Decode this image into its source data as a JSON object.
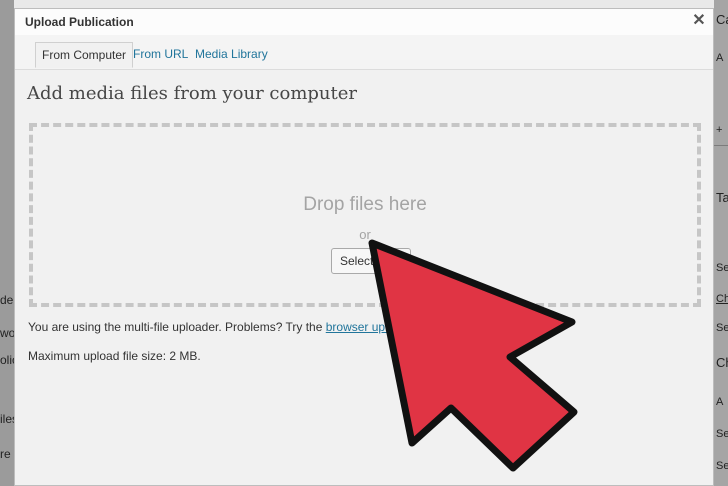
{
  "modal": {
    "title": "Upload Publication",
    "close_icon": "close-icon",
    "tabs": [
      {
        "label": "From Computer",
        "active": true
      },
      {
        "label": "From URL",
        "active": false
      },
      {
        "label": "Media Library",
        "active": false
      }
    ],
    "heading": "Add media files from your computer",
    "dropzone": {
      "drop_text": "Drop files here",
      "or_text": "or",
      "select_button": "Select Files"
    },
    "info": {
      "prefix": "You are using the multi-file uploader. Problems? Try the ",
      "link": "browser uplo"
    },
    "max_size": "Maximum upload file size: 2 MB."
  },
  "background": {
    "left_fragments": [
      "de",
      "wo",
      "olio",
      "iles",
      "re c"
    ],
    "right_fragments": [
      "Ca",
      "A",
      "+",
      "Ta",
      "Se",
      "Ch",
      "Se",
      "Ch",
      "A",
      "Se",
      "Se"
    ]
  },
  "colors": {
    "link": "#21759b",
    "arrow_fill": "#e03444",
    "arrow_stroke": "#111111"
  }
}
